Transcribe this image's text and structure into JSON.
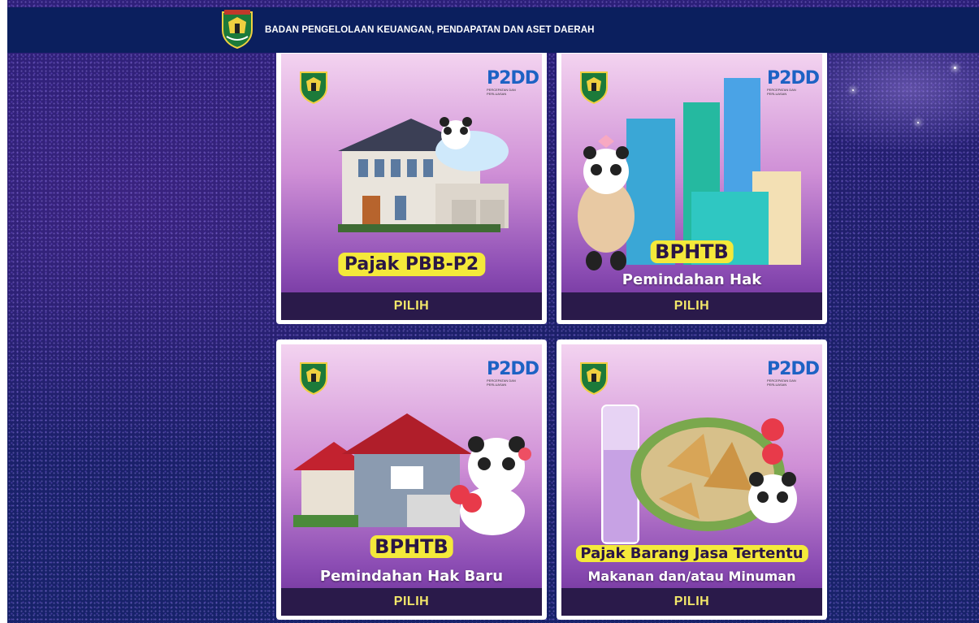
{
  "header": {
    "title": "BADAN PENGELOLAAN KEUANGAN, PENDAPATAN DAN ASET DAERAH",
    "logo_icon": "regency-shield-logo-icon"
  },
  "colors": {
    "header_bg": "#0b1f5e",
    "background": "#1d1f6a",
    "button_bg": "#2a1a4a",
    "button_text": "#f3e86a",
    "label_yellow": "#f4e93a"
  },
  "cards": [
    {
      "title": "Pajak PBB-P2",
      "subtitle": "",
      "button": "PILIH",
      "illustration": "house-panda-cloud"
    },
    {
      "title": "BPHTB",
      "subtitle": "Pemindahan Hak",
      "button": "PILIH",
      "illustration": "city-buildings-panda"
    },
    {
      "title": "BPHTB",
      "subtitle": "Pemindahan Hak Baru",
      "button": "PILIH",
      "illustration": "red-house-panda-hearts"
    },
    {
      "title": "Pajak Barang Jasa Tertentu",
      "subtitle": "Makanan dan/atau Minuman",
      "button": "PILIH",
      "illustration": "food-drink-panda"
    }
  ],
  "badge": {
    "text": "P2DD"
  }
}
